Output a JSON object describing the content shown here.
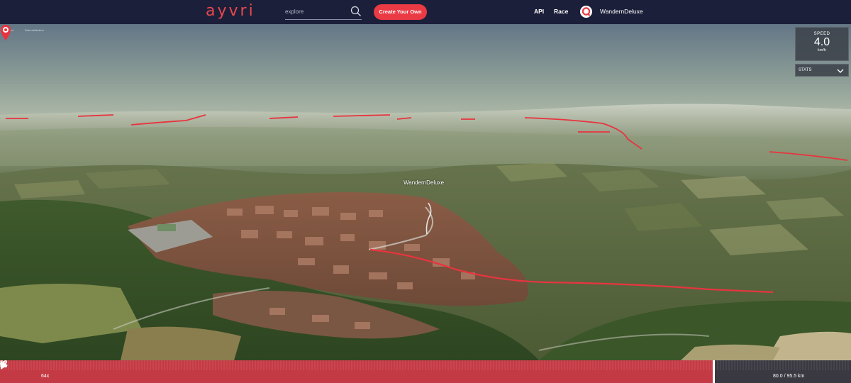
{
  "header": {
    "logo": "ayvri",
    "search_placeholder": "explore",
    "create_label": "Create Your Own",
    "nav_api": "API",
    "nav_race": "Race",
    "username": "WandernDeluxe"
  },
  "map": {
    "attribution": [
      "©cesium",
      "Data attribution"
    ],
    "marker_label": "WandernDeluxe"
  },
  "speed_panel": {
    "label": "SPEED",
    "value": "4.0",
    "unit": "km/h"
  },
  "stats": {
    "label": "STATS"
  },
  "playback": {
    "speed_multiplier": "64x",
    "distance": "80.0 / 95.5 km",
    "progress_fraction": 0.838
  },
  "colors": {
    "nav_bg": "#1c1f3a",
    "accent": "#ea3a44",
    "track": "#e8343f"
  },
  "icons": [
    "search-icon",
    "avatar-logo",
    "marker-pin-icon",
    "chevron-down-icon",
    "minus-icon",
    "play-icon",
    "plus-icon",
    "chart-icon",
    "share-icon",
    "fullscreen-icon"
  ]
}
